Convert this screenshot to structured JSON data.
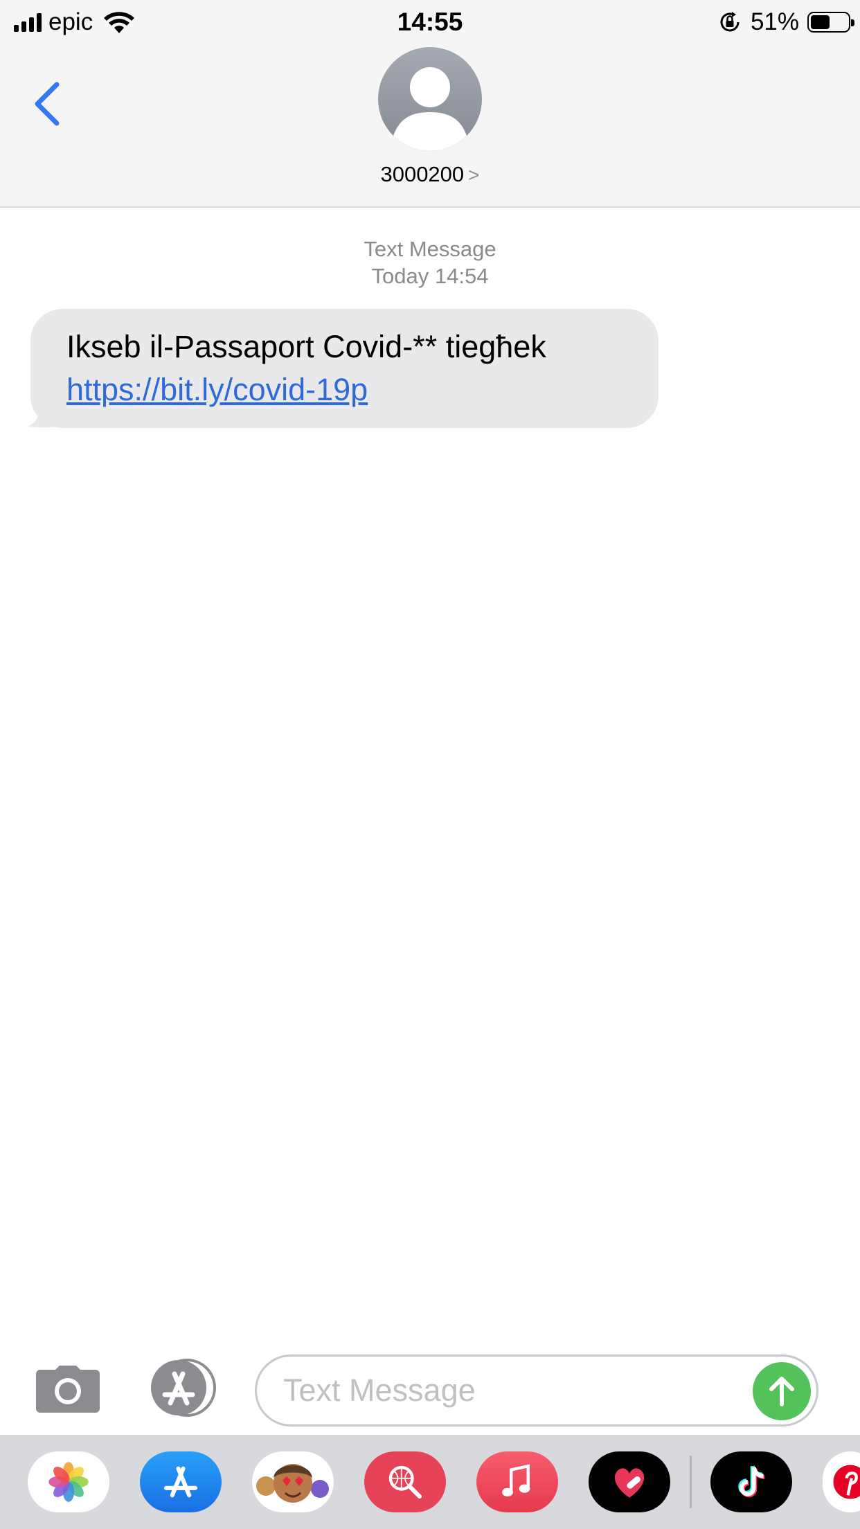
{
  "status_bar": {
    "carrier": "epic",
    "time": "14:55",
    "battery_percent": "51%",
    "battery_level": 0.51
  },
  "header": {
    "back_icon": "chevron-left-icon",
    "avatar_icon": "person-silhouette-icon",
    "contact_name": "3000200",
    "contact_chevron": ">"
  },
  "conversation": {
    "service_label": "Text Message",
    "timestamp": "Today 14:54",
    "messages": [
      {
        "direction": "incoming",
        "text": "Ikseb il-Passaport Covid-** tiegħek",
        "link": "https://bit.ly/covid-19p"
      }
    ]
  },
  "input_bar": {
    "camera_icon": "camera-icon",
    "apps_icon": "app-store-icon",
    "placeholder": "Text Message",
    "value": "",
    "send_icon": "arrow-up-icon"
  },
  "app_drawer": {
    "apps": [
      "photos-icon",
      "app-store-icon",
      "memoji-icon",
      "web-search-icon",
      "music-icon",
      "heart-app-icon",
      "tiktok-icon",
      "pinterest-icon"
    ]
  },
  "colors": {
    "link": "#2f6bd8",
    "back_chevron": "#3478f6",
    "incoming_bubble": "#e9e9eb",
    "send_button": "#53c25a",
    "header_bg": "#f5f5f5",
    "timestamp": "#8a8a8e"
  }
}
